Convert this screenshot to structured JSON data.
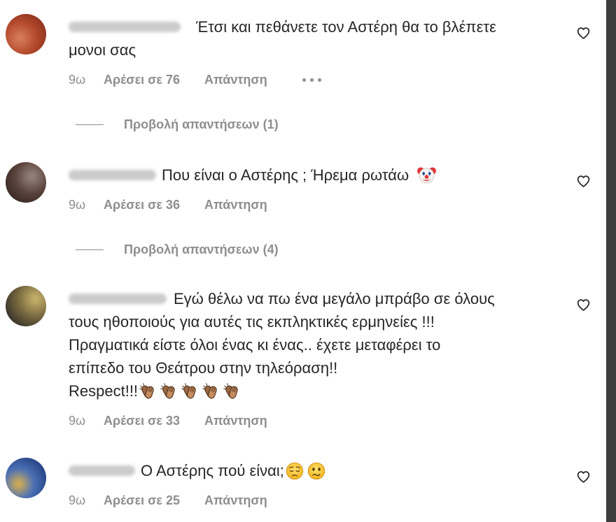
{
  "colors": {
    "background": "#ffffff",
    "text": "#262626",
    "muted": "#8e8e8e",
    "window_edge": "#3d3d3d"
  },
  "comments": [
    {
      "lines": [
        {
          "text": "Έτσι και πεθάνετε τον Αστέρη θα το βλέπετε",
          "emoji": []
        },
        {
          "text": "μονοι σας",
          "emoji": []
        }
      ],
      "time": "9ω",
      "likes": "Αρέσει σε 76",
      "reply": "Απάντηση",
      "more_icon": "more-options-icon",
      "like_icon": "heart-outline-icon",
      "view_replies": "Προβολή απαντήσεων (1)"
    },
    {
      "lines": [
        {
          "text": "Που είναι ο Αστέρης ; Ήρεμα ρωτάω",
          "emoji": [
            "clown-face"
          ]
        }
      ],
      "time": "9ω",
      "likes": "Αρέσει σε 36",
      "reply": "Απάντηση",
      "like_icon": "heart-outline-icon",
      "view_replies": "Προβολή απαντήσεων (4)"
    },
    {
      "lines": [
        {
          "text": "Εγώ θέλω να πω ένα μεγάλο μπράβο σε όλους",
          "emoji": []
        },
        {
          "text": "τους ηθοποιούς για αυτές τις εκπληκτικές ερμηνείες !!!",
          "emoji": []
        },
        {
          "text": "Πραγματικά είστε όλοι ένας κι ένας.. έχετε μεταφέρει το",
          "emoji": []
        },
        {
          "text": "επίπεδο του Θεάτρου στην τηλεόραση!!",
          "emoji": []
        },
        {
          "text": "Respect!!!",
          "emoji": [
            "clapping-hands-medium-skin-tone",
            "clapping-hands-medium-skin-tone",
            "clapping-hands-medium-skin-tone",
            "clapping-hands-medium-skin-tone",
            "clapping-hands-medium-skin-tone"
          ]
        }
      ],
      "time": "9ω",
      "likes": "Αρέσει σε 33",
      "reply": "Απάντηση",
      "like_icon": "heart-outline-icon"
    },
    {
      "lines": [
        {
          "text": "Ο Αστέρης πού είναι;",
          "emoji": [
            "pensive-face",
            "confused-face"
          ]
        }
      ],
      "time": "9ω",
      "likes": "Αρέσει σε 25",
      "reply": "Απάντηση",
      "like_icon": "heart-outline-icon"
    }
  ]
}
